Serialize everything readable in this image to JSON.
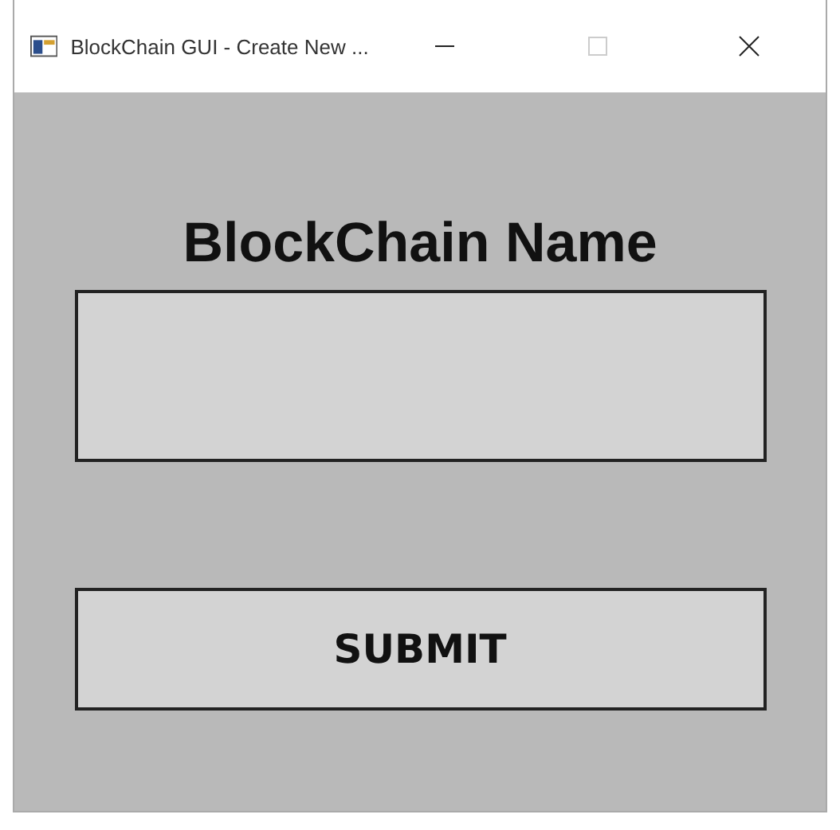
{
  "window": {
    "title": "BlockChain GUI - Create New ...",
    "maximize_disabled": true
  },
  "heading": "BlockChain Name",
  "submit_button": {
    "label": "SUBMIT"
  }
}
